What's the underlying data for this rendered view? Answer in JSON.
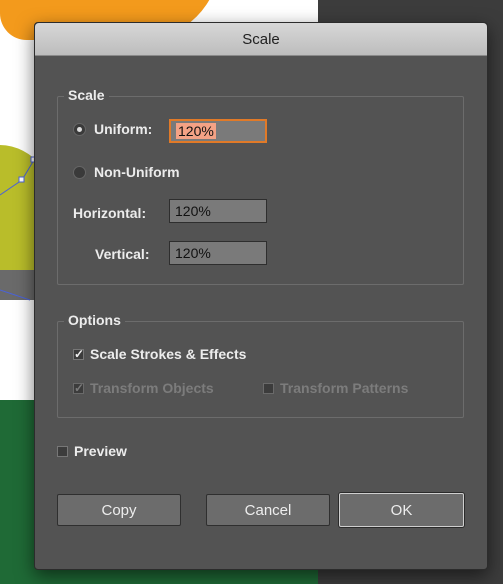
{
  "dialog": {
    "title": "Scale"
  },
  "scale_group": {
    "legend": "Scale",
    "uniform_label": "Uniform:",
    "uniform_value": "120%",
    "non_uniform_label": "Non-Uniform",
    "horizontal_label": "Horizontal:",
    "horizontal_value": "120%",
    "vertical_label": "Vertical:",
    "vertical_value": "120%",
    "selected_mode": "Uniform"
  },
  "options_group": {
    "legend": "Options",
    "scale_strokes_label": "Scale Strokes & Effects",
    "scale_strokes_checked": true,
    "transform_objects_label": "Transform Objects",
    "transform_objects_checked": true,
    "transform_patterns_label": "Transform Patterns",
    "transform_patterns_checked": false
  },
  "preview": {
    "label": "Preview",
    "checked": false
  },
  "buttons": {
    "copy": "Copy",
    "cancel": "Cancel",
    "ok": "OK"
  },
  "colors": {
    "focus": "#e17a28",
    "dialog_bg": "#535353"
  }
}
